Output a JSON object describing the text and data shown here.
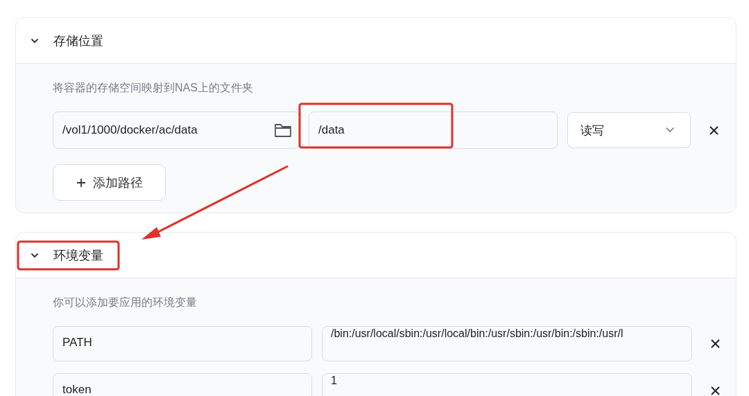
{
  "sections": [
    {
      "title": "存储位置",
      "expanded": true,
      "description": "将容器的存储空间映射到NAS上的文件夹",
      "rows": [
        {
          "kind": "volume",
          "host_path": "/vol1/1000/docker/ac/data",
          "container_path": "/data",
          "mode": "读写"
        }
      ],
      "add_button": "添加路径"
    },
    {
      "title": "环境变量",
      "expanded": true,
      "description": "你可以添加要应用的环境变量",
      "rows": [
        {
          "kind": "env",
          "key": "PATH",
          "value": "/bin:/usr/local/sbin:/usr/local/bin:/usr/sbin:/usr/bin:/sbin:/usr/l"
        },
        {
          "kind": "env",
          "key": "token",
          "value": "1"
        }
      ]
    }
  ]
}
